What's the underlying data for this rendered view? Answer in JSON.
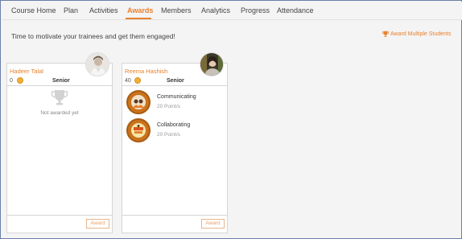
{
  "nav": {
    "items": [
      {
        "label": "Course Home",
        "active": false
      },
      {
        "label": "Plan",
        "active": false
      },
      {
        "label": "Activities",
        "active": false
      },
      {
        "label": "Awards",
        "active": true
      },
      {
        "label": "Members",
        "active": false
      },
      {
        "label": "Analytics",
        "active": false
      },
      {
        "label": "Progress",
        "active": false
      },
      {
        "label": "Attendance",
        "active": false
      }
    ]
  },
  "intro_text": "Time to motivate your trainees and get them engaged!",
  "award_multiple_label": "Award Multiple Students",
  "accent_color": "#e8812e",
  "students": [
    {
      "name": "Hadeer Talal",
      "points": "0",
      "rank": "Senior",
      "empty_text": "Not awarded yet",
      "award_label": "Award",
      "avatar_icon": "user-photo"
    },
    {
      "name": "Reema Hashish",
      "points": "40",
      "rank": "Senior",
      "award_label": "Award",
      "avatar_icon": "user-photo",
      "badges": [
        {
          "title": "Communicating",
          "points": "20 Point/s",
          "icon": "communicating-badge-icon"
        },
        {
          "title": "Collaborating",
          "points": "20 Point/s",
          "icon": "collaborating-badge-icon"
        }
      ]
    }
  ]
}
